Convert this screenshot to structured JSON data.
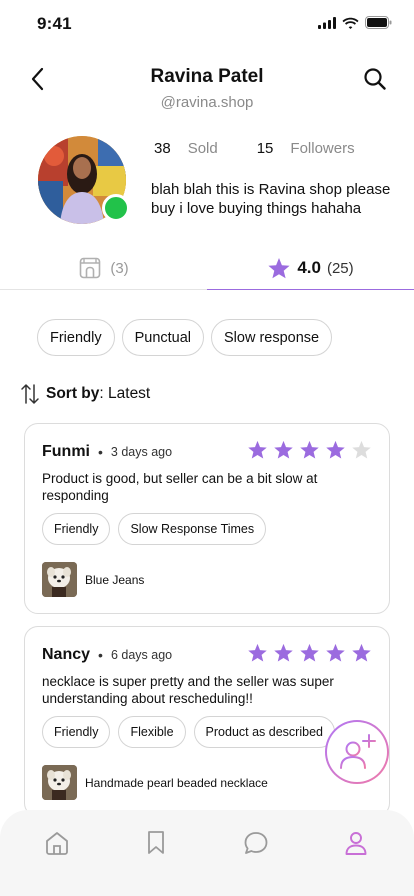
{
  "status_bar": {
    "time": "9:41"
  },
  "header": {
    "name": "Ravina Patel",
    "handle": "@ravina.shop"
  },
  "profile": {
    "sold_count": "38",
    "sold_label": "Sold",
    "followers_count": "15",
    "followers_label": "Followers",
    "bio": "blah blah this is Ravina shop please buy i love buying things hahaha",
    "online": true
  },
  "tabs": {
    "shop_count": "(3)",
    "rating": "4.0",
    "reviews_count": "(25)"
  },
  "filter_chips": [
    "Friendly",
    "Punctual",
    "Slow response"
  ],
  "sort": {
    "label": "Sort by",
    "value": ": Latest"
  },
  "reviews": [
    {
      "name": "Funmi",
      "separator": "•",
      "time": "3 days ago",
      "stars": 4,
      "text": "Product is good, but seller can be a bit slow at responding",
      "tags": [
        "Friendly",
        "Slow Response Times"
      ],
      "product": "Blue Jeans"
    },
    {
      "name": "Nancy",
      "separator": "•",
      "time": "6 days ago",
      "stars": 5,
      "text": "necklace is super pretty and the seller was super understanding about rescheduling!!",
      "tags": [
        "Friendly",
        "Flexible",
        "Product as described"
      ],
      "product": "Handmade pearl beaded necklace"
    }
  ],
  "colors": {
    "accent": "#9b6bdf",
    "star": "#9b6bdf",
    "star_empty": "#dddddd",
    "online": "#22c24a",
    "nav_active": "#c86fd6"
  },
  "bottom_nav": {
    "items": [
      "home-icon",
      "bookmark-icon",
      "chat-icon",
      "profile-icon"
    ],
    "active": "profile-icon"
  }
}
